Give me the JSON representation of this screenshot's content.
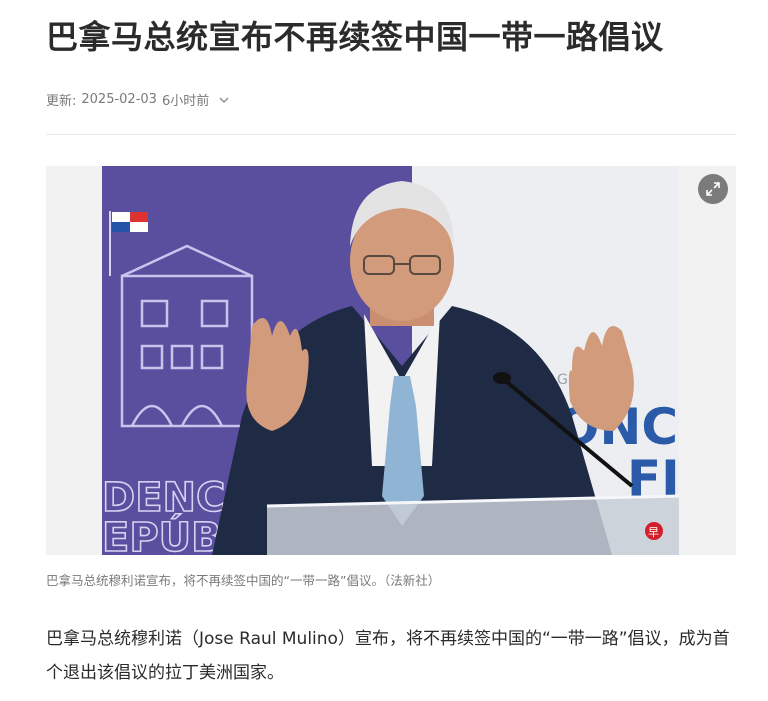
{
  "article": {
    "headline": "巴拿马总统宣布不再续签中国一带一路倡议",
    "updated_label": "更新:",
    "updated_date": "2025-02-03",
    "updated_relative": "6小时前",
    "expand_icon": "expand-icon",
    "photo_caption": "巴拿马总统穆利诺宣布，将不再续签中国的“一带一路”倡议。（法新社）",
    "body": "巴拿马总统穆利诺（Jose Raul Mulino）宣布，将不再续签中国的“一带一路”倡议，成为首个退出该倡议的拉丁美洲国家。"
  },
  "photo": {
    "backdrop_text_left_1": "DENC",
    "backdrop_text_left_2": "EPÚBL",
    "backdrop_text_right_1": "G",
    "backdrop_text_right_2": "ONC",
    "backdrop_text_right_3": "FI",
    "watermark": "早"
  },
  "colors": {
    "backdrop_purple": "#5a4e9e",
    "headline": "#2b2b2b",
    "meta": "#7a7a7a",
    "suit": "#1f2a44",
    "tie": "#8fb4d4"
  }
}
